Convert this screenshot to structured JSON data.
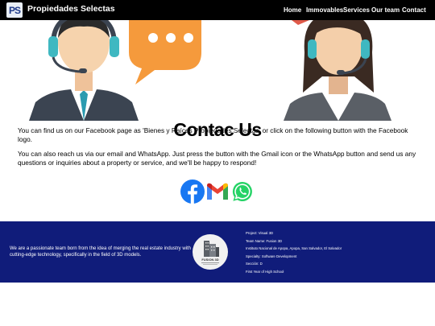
{
  "brand": {
    "logo_text": "PS",
    "name": "Propiedades Selectas"
  },
  "nav": {
    "items": [
      {
        "label": "Home"
      },
      {
        "label": "Immovables"
      },
      {
        "label": "Services"
      },
      {
        "label": "Our team"
      },
      {
        "label": "Contact"
      }
    ]
  },
  "main": {
    "heading": "Contac Us",
    "paragraph1": "You can find us on our Facebook page as 'Bienes y Raíces Propiedades Selectas' or click on the following button with the Facebook logo.",
    "paragraph2": "You can also reach us via our email and WhatsApp. Just press the button with the Gmail icon or the WhatsApp button and send us any questions or inquiries about a property or service, and we'll be happy to respond!",
    "social_icons": [
      "facebook-icon",
      "gmail-icon",
      "whatsapp-icon"
    ]
  },
  "footer": {
    "tagline": "We are a passionate team born from the idea of merging the real estate industry with cutting-edge technology, specifically in the field of 3D models.",
    "logo_text": "FUSION 3D",
    "info": [
      "Project: Visual 3D",
      "Team Name: Fusion 3D",
      "Instituto Nacional de Apopa, Apopa, San Salvador, El Salvador",
      "Specialty: Software Development",
      "Sección: D",
      "First Year of High School"
    ]
  },
  "colors": {
    "navbar_bg": "#000000",
    "footer_bg": "#101c7a",
    "speech_bubble": "#f59a3c",
    "headset": "#3fb8c1",
    "facebook": "#1877f2",
    "whatsapp": "#25d366"
  }
}
